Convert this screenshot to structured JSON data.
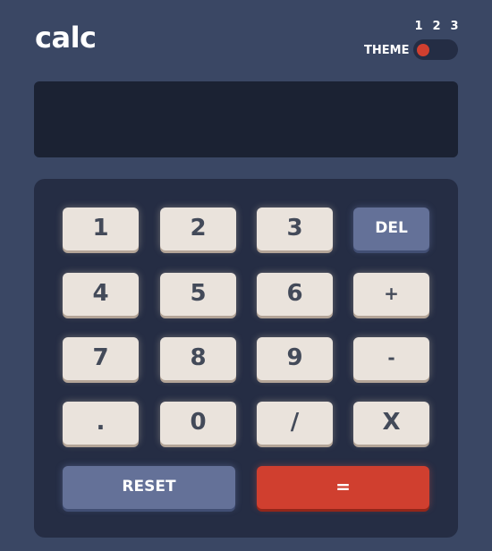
{
  "header": {
    "logo": "calc",
    "theme_label": "THEME",
    "theme_numbers": [
      "1",
      "2",
      "3"
    ],
    "theme_selected": 1
  },
  "display": {
    "value": ""
  },
  "keys": {
    "k1": "1",
    "k2": "2",
    "k3": "3",
    "del": "DEL",
    "k4": "4",
    "k5": "5",
    "k6": "6",
    "plus": "+",
    "k7": "7",
    "k8": "8",
    "k9": "9",
    "minus": "-",
    "dot": ".",
    "k0": "0",
    "divide": "/",
    "multiply": "X",
    "reset": "RESET",
    "equals": "="
  },
  "colors": {
    "background": "#3a4764",
    "screen": "#1b2233",
    "keypad": "#252d44",
    "key": "#eae3dc",
    "key_text": "#434a59",
    "accent_blue": "#647198",
    "accent_red": "#d03f2f"
  }
}
